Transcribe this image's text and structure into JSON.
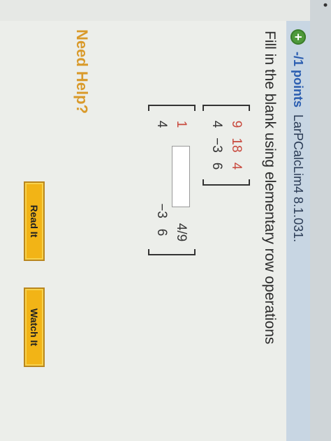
{
  "header": {
    "points_label": "-/1 points",
    "problem_id": "LarPCalcLim4 8.1.031."
  },
  "question": {
    "instruction": "Fill in the blank using elementary row operations",
    "matrix1": [
      [
        "9",
        "18",
        "4"
      ],
      [
        "4",
        "−3",
        "6"
      ]
    ],
    "matrix2": {
      "row1": {
        "first": "1",
        "last": "4/9"
      },
      "row2": {
        "first": "4",
        "middle": "−3",
        "last": "6"
      }
    }
  },
  "help": {
    "need_help": "Need Help?",
    "read_it": "Read It",
    "watch_it": "Watch It"
  },
  "colors": {
    "accent_red": "#c8483c",
    "button": "#f2b416",
    "link_blue": "#2a5db0"
  }
}
